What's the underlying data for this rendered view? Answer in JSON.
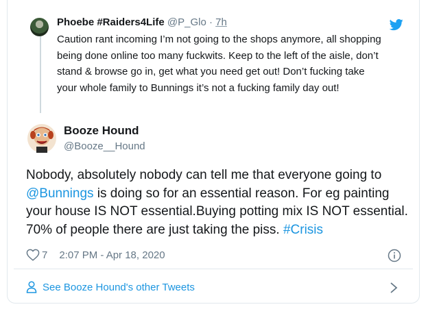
{
  "quoted_tweet": {
    "name": "Phoebe #Raiders4Life",
    "handle": "@P_Glo",
    "separator": "·",
    "time": "7h",
    "text": "Caution rant incoming I’m not going to the shops anymore, all shopping being done online too many fuckwits. Keep to the left of the aisle, don’t stand & browse go in, get what you need get out! Don’t fucking take your whole family to Bunnings it’s not a fucking family day out!"
  },
  "main_tweet": {
    "name": "Booze Hound",
    "handle": "@Booze__Hound",
    "text_parts": {
      "p1": "Nobody, absolutely nobody can tell me that everyone going to ",
      "mention": "@Bunnings",
      "p2": " is doing so for an essential reason. For eg painting your house IS NOT essential.Buying potting mix IS NOT essential. 70% of people there are just taking the piss. ",
      "hashtag": "#Crisis"
    },
    "likes": "7",
    "timestamp": "2:07 PM - Apr 18, 2020"
  },
  "footer": {
    "see_more": "See Booze Hound's other Tweets"
  },
  "icons": {
    "brand": "twitter-bird-icon",
    "like": "heart-icon",
    "info": "info-icon",
    "profile": "person-icon",
    "chevron": "chevron-right-icon"
  },
  "colors": {
    "link": "#1b95e0",
    "muted": "#657786",
    "text": "#14171a",
    "border": "#e1e8ed"
  }
}
